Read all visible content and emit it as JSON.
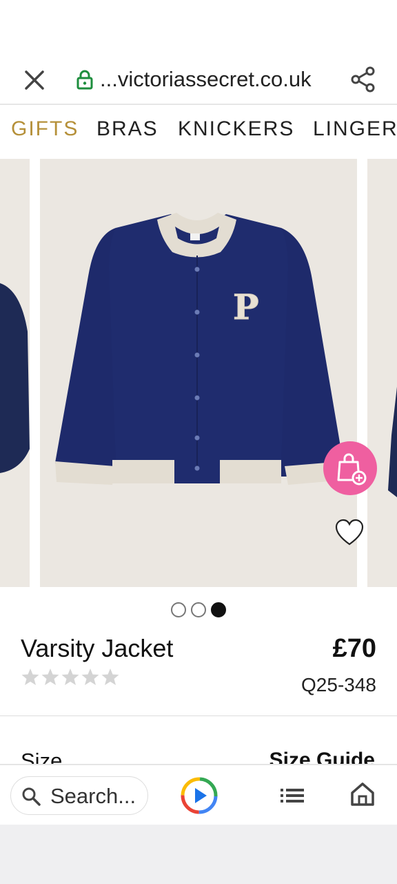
{
  "browser": {
    "url": "...victoriassecret.co.uk"
  },
  "nav": {
    "categories": [
      {
        "label": "GIFTS",
        "active": true
      },
      {
        "label": "BRAS",
        "active": false
      },
      {
        "label": "KNICKERS",
        "active": false
      },
      {
        "label": "LINGER",
        "active": false
      }
    ]
  },
  "carousel": {
    "slide_count": 3,
    "active_slide": 3,
    "logo_letter": "P"
  },
  "product": {
    "name": "Varsity Jacket",
    "price": "£70",
    "sku": "Q25-348",
    "rating": 0,
    "rating_max": 5
  },
  "options": {
    "size_label": "Size",
    "size_guide_label": "Size Guide"
  },
  "bottom_bar": {
    "search_placeholder": "Search..."
  },
  "colors": {
    "accent_gold": "#b59039",
    "pink": "#ef5fa0",
    "navy": "#1e2a6b",
    "secure_green": "#1e8e3e"
  }
}
